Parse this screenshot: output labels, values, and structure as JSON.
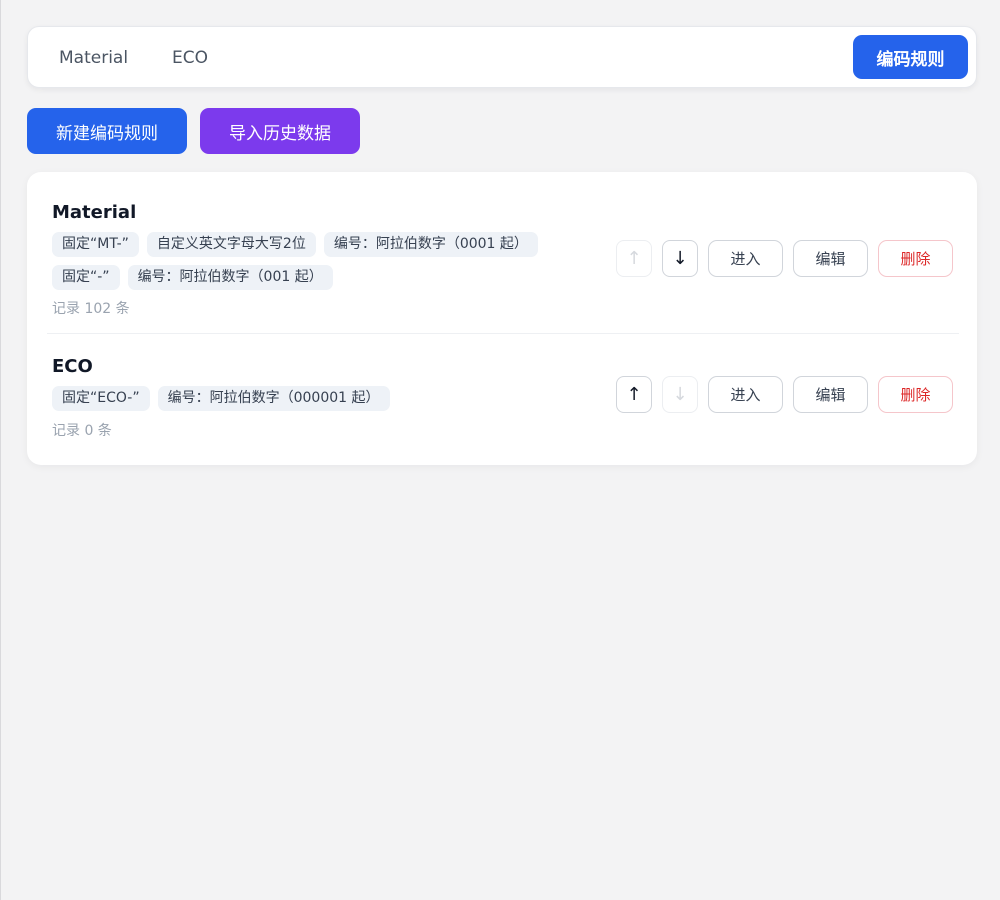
{
  "header": {
    "tabs": [
      {
        "label": "Material"
      },
      {
        "label": "ECO"
      }
    ],
    "rules_button": "编码规则"
  },
  "actions": {
    "new_rule": "新建编码规则",
    "import_history": "导入历史数据"
  },
  "rules": [
    {
      "name": "Material",
      "segments_line1": [
        "固定“MT-”",
        "自定义英文字母大写2位",
        "编号：阿拉伯数字（0001 起）"
      ],
      "segments_line2": [
        "固定“-”",
        "编号：阿拉伯数字（001 起）"
      ],
      "record": "记录 102 条",
      "up_icon": "↑",
      "down_icon": "↓",
      "up_enabled": false,
      "down_enabled": true,
      "enter": "进入",
      "edit": "编辑",
      "delete": "删除"
    },
    {
      "name": "ECO",
      "segments_line1": [
        "固定“ECO-”",
        "编号：阿拉伯数字（000001 起）"
      ],
      "record": "记录 0 条",
      "up_icon": "↑",
      "down_icon": "↓",
      "up_enabled": true,
      "down_enabled": false,
      "enter": "进入",
      "edit": "编辑",
      "delete": "删除"
    }
  ],
  "colors": {
    "primary": "#2563eb",
    "import": "#7c3aed",
    "danger": "#dc2626"
  }
}
